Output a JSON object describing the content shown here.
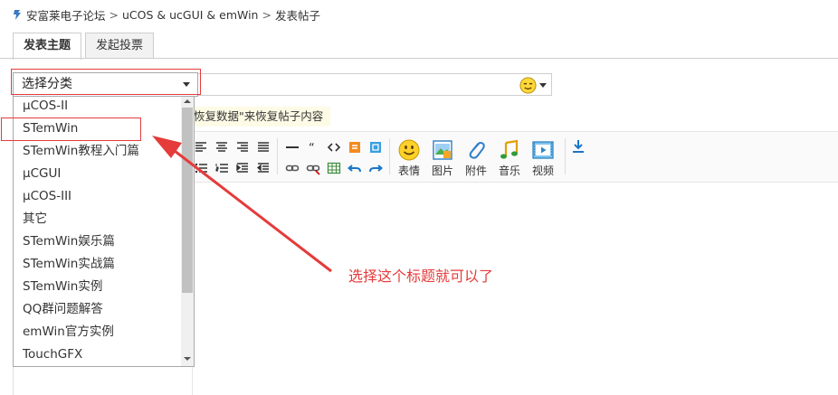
{
  "breadcrumb": {
    "items": [
      "安富莱电子论坛",
      "uCOS & ucGUI & emWin",
      "发表帖子"
    ],
    "separator": ">"
  },
  "tabs": [
    {
      "label": "发表主题",
      "active": true
    },
    {
      "label": "发起投票",
      "active": false
    }
  ],
  "category_select": {
    "selected": "选择分类",
    "options": [
      "μCOS-II",
      "STemWin",
      "STemWin教程入门篇",
      "μCGUI",
      "μCOS-III",
      "其它",
      "STemWin娱乐篇",
      "STemWin实战篇",
      "STemWin实例",
      "QQ群问题解答",
      "emWin官方实例",
      "TouchGFX"
    ],
    "highlighted_option": "STemWin"
  },
  "restore_bar": {
    "text": "恢复数据\"来恢复帖子内容"
  },
  "toolbar": {
    "buttons": [
      {
        "label": "表情",
        "icon": "smiley-icon"
      },
      {
        "label": "图片",
        "icon": "image-icon"
      },
      {
        "label": "附件",
        "icon": "paperclip-icon"
      },
      {
        "label": "音乐",
        "icon": "music-icon"
      },
      {
        "label": "视频",
        "icon": "video-icon"
      }
    ]
  },
  "annotation": {
    "text": "选择这个标题就可以了",
    "color": "#e53b3b"
  }
}
